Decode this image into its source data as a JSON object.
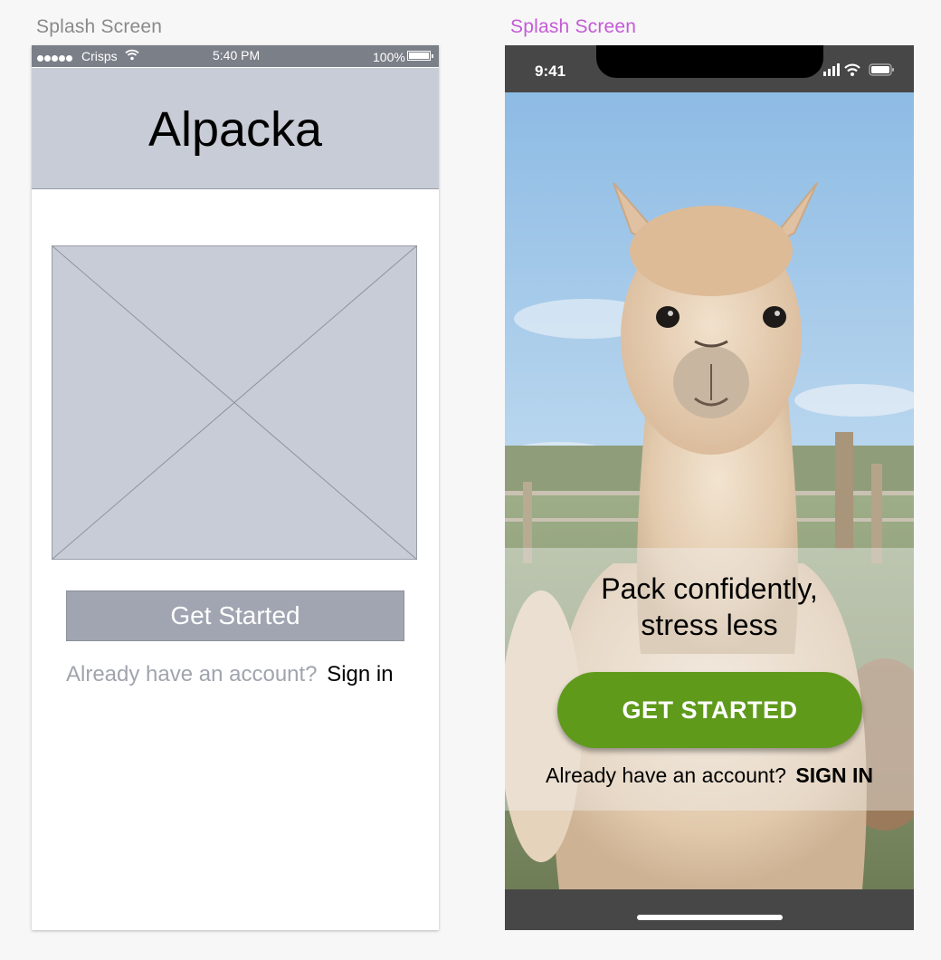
{
  "artboards": {
    "left_label": "Splash Screen",
    "right_label": "Splash Screen"
  },
  "wireframe": {
    "status_bar": {
      "carrier": "Crisps",
      "time": "5:40 PM",
      "battery": "100%"
    },
    "title": "Alpacka",
    "image_placeholder_icon": "image-placeholder-icon",
    "get_started_label": "Get Started",
    "signin_prompt": "Already have an account?",
    "signin_link": "Sign in"
  },
  "mockup": {
    "status_bar": {
      "time": "9:41"
    },
    "tagline_line1": "Pack confidently,",
    "tagline_line2": "stress less",
    "cta_label": "GET STARTED",
    "signin_prompt": "Already have an account?",
    "signin_link": "SIGN IN",
    "colors": {
      "cta": "#5f9a1b",
      "label_accent": "#c45ad6",
      "frame": "#474747"
    }
  }
}
